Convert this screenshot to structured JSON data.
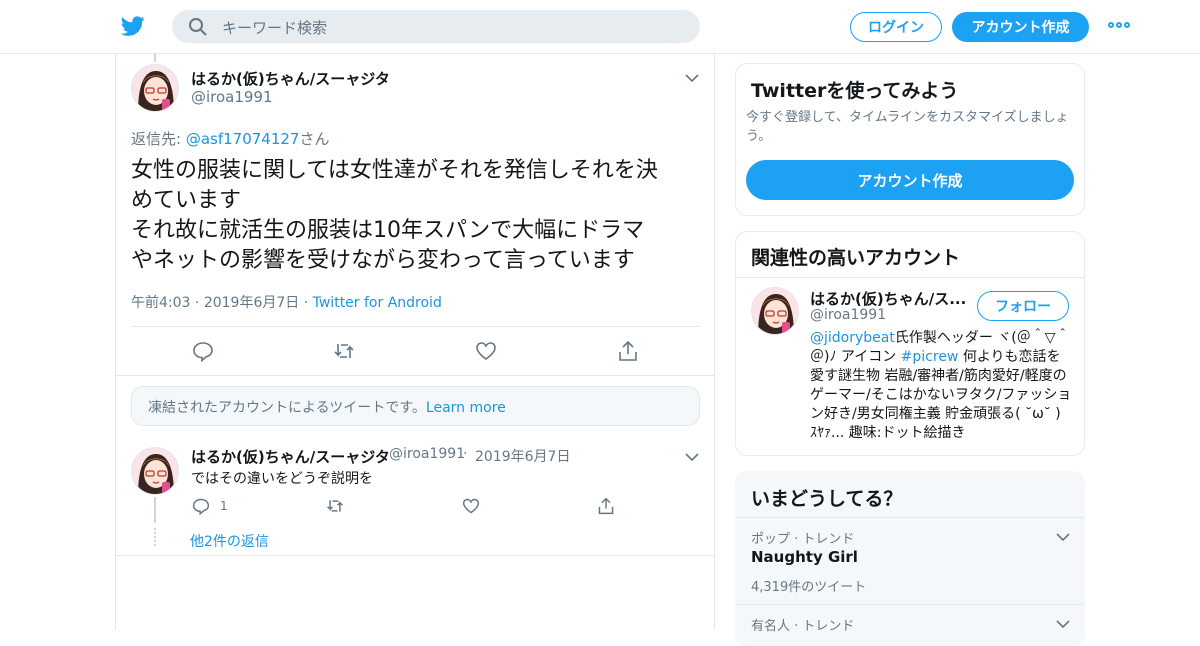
{
  "header": {
    "search_placeholder": "キーワード検索",
    "login_label": "ログイン",
    "signup_label": "アカウント作成"
  },
  "main_tweet": {
    "display_name": "はるか(仮)ちゃん/スーャジタ",
    "handle": "@iroa1991",
    "reply_prefix": "返信先: ",
    "reply_to": "@asf17074127",
    "reply_suffix": "さん",
    "text_line1": "女性の服装に関しては女性達がそれを発信しそれを決",
    "text_line2": "めています",
    "text_line3": "それ故に就活生の服装は10年スパンで大幅にドラマ",
    "text_line4": "やネットの影響を受けながら変わって言っています",
    "time": "午前4:03",
    "date": "2019年6月7日",
    "source": "Twitter for Android"
  },
  "frozen_notice": {
    "text": "凍結されたアカウントによるツイートです。",
    "link": "Learn more"
  },
  "reply_tweet": {
    "display_name": "はるか(仮)ちゃん/スーャジタ",
    "handle": "@iroa1991",
    "date": "2019年6月7日",
    "text": "ではその違いをどうぞ説明を",
    "reply_count": "1",
    "more_replies": "他2件の返信"
  },
  "signup_card": {
    "title": "Twitterを使ってみよう",
    "subtitle": "今すぐ登録して、タイムラインをカスタマイズしましょう。",
    "button": "アカウント作成"
  },
  "related_card": {
    "title": "関連性の高いアカウント",
    "display_name": "はるか(仮)ちゃん/ス...",
    "handle": "@iroa1991",
    "follow": "フォロー",
    "bio_link1": "@jidorybeat",
    "bio_text1": "氏作製ヘッダー ヾ(＠＾▽＾＠)ﾉ アイコン ",
    "bio_link2": "#picrew",
    "bio_text2": " 何よりも恋話を愛す謎生物 岩融/審神者/筋肉愛好/軽度のゲーマー/そこはかないヲタク/ファッション好き/男女同権主義 貯金頑張る( ˘ω˘ ) ｽﾔｧ... 趣味:ドット絵描き"
  },
  "trends_card": {
    "title": "いまどうしてる？",
    "trend1_category": "ポップ · トレンド",
    "trend1_name": "Naughty Girl",
    "trend1_count": "4,319件のツイート",
    "trend2_category": "有名人 · トレンド"
  },
  "colors": {
    "accent": "#1da1f2",
    "link": "#1b95e0",
    "border": "#e1e8ed",
    "muted": "#657786"
  },
  "icons": [
    "twitter-bird-icon",
    "search-icon",
    "more-dots-icon",
    "chevron-down-icon",
    "reply-icon",
    "retweet-icon",
    "like-icon",
    "share-icon"
  ]
}
